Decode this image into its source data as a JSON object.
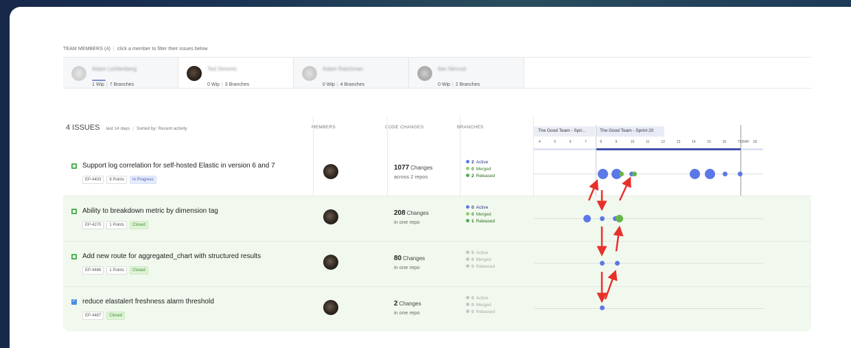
{
  "team": {
    "caption_count": "TEAM MEMBERS (4)",
    "caption_hint": "click a member to filter their issues below",
    "members": [
      {
        "name": "Adam Lichtenberg",
        "wip": "1 Wip",
        "branches": "7 Branches"
      },
      {
        "name": "Ted Simonic",
        "wip": "0 Wip",
        "branches": "3 Branches"
      },
      {
        "name": "Adam Raichman",
        "wip": "0 Wip",
        "branches": "4 Branches"
      },
      {
        "name": "Ilan Nimrod",
        "wip": "0 Wip",
        "branches": "2 Branches"
      }
    ]
  },
  "issues_header": {
    "title": "4 ISSUES",
    "period": "last 14 days",
    "sort": "Sorted by: Recent activity",
    "col_members": "MEMBERS",
    "col_changes": "CODE CHANGES",
    "col_branches": "BRANCHES"
  },
  "timeline": {
    "sprint_prev": "The Good Team - Spri...",
    "sprint_current": "The Good Team - Sprint 20",
    "days": [
      "4",
      "5",
      "6",
      "7",
      "8",
      "9",
      "10",
      "11",
      "12",
      "13",
      "14",
      "15",
      "16",
      "TODAY",
      "18"
    ]
  },
  "issues": [
    {
      "title": "Support log correlation for self-hosted Elastic in version 6 and 7",
      "key": "EP-4403",
      "points": "8 Points",
      "status": "In Progress",
      "changes": "1077",
      "changes_label": "Changes",
      "repos": "across 2 repos",
      "active": "2",
      "merged": "0",
      "released": "2",
      "active_label": "Active",
      "merged_label": "Merged",
      "released_label": "Released"
    },
    {
      "title": "Ability to breakdown metric by dimension tag",
      "key": "EP-4270",
      "points": "1 Points",
      "status": "Closed",
      "changes": "208",
      "changes_label": "Changes",
      "repos": "in one repo",
      "active": "0",
      "merged": "0",
      "released": "1",
      "active_label": "Active",
      "merged_label": "Merged",
      "released_label": "Released"
    },
    {
      "title": "Add new route for aggregated_chart with structured results",
      "key": "EP-4486",
      "points": "1 Points",
      "status": "Closed",
      "changes": "80",
      "changes_label": "Changes",
      "repos": "in one repo",
      "active": "0",
      "merged": "0",
      "released": "0",
      "active_label": "Active",
      "merged_label": "Merged",
      "released_label": "Released"
    },
    {
      "title": "reduce elastalert freshness alarm threshold",
      "key": "EP-4487",
      "status": "Closed",
      "changes": "2",
      "changes_label": "Changes",
      "repos": "in one repo",
      "active": "0",
      "merged": "0",
      "released": "0",
      "active_label": "Active",
      "merged_label": "Merged",
      "released_label": "Released"
    }
  ],
  "colors": {
    "background": "#16294a",
    "active": "#5c78e8",
    "merged": "#8fd16e",
    "released": "#4caf50",
    "inactive": "#bdbdbd",
    "arrow": "#e8302a",
    "closed_tag": "#dff3d8"
  }
}
